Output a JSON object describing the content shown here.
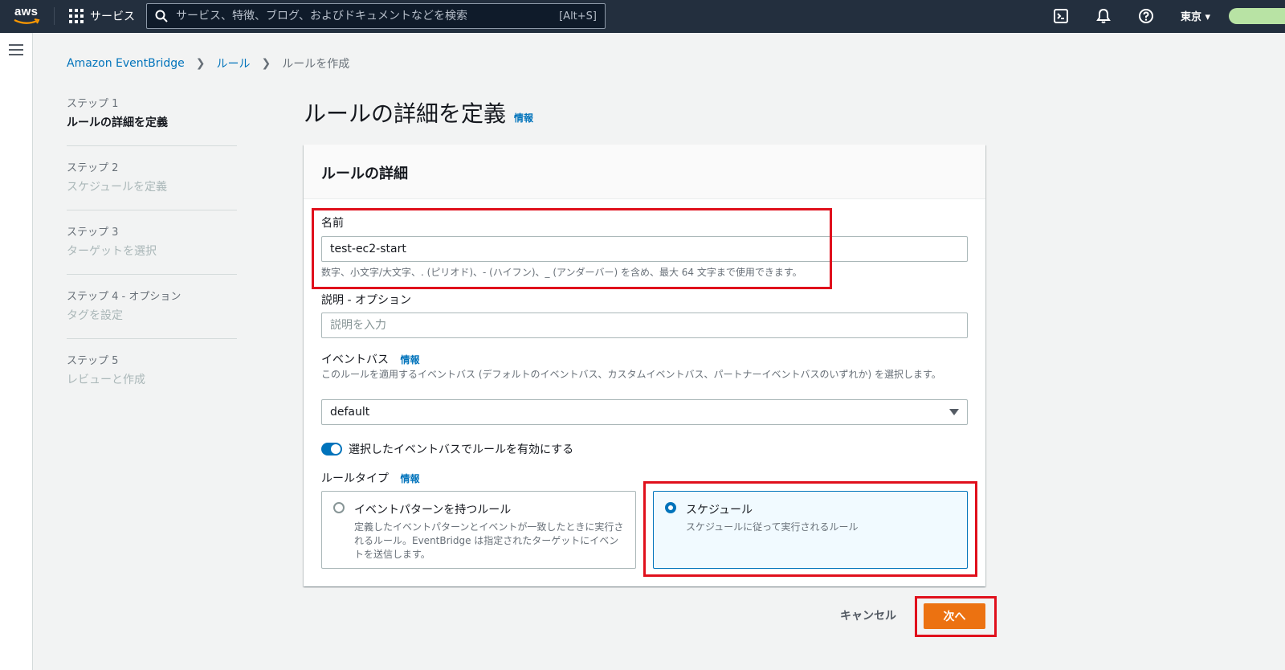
{
  "topnav": {
    "logo_text": "aws",
    "services_label": "サービス",
    "search_placeholder": "サービス、特徴、ブログ、およびドキュメントなどを検索",
    "search_shortcut": "[Alt+S]",
    "region": "東京 ▾"
  },
  "breadcrumb": {
    "items": [
      "Amazon EventBridge",
      "ルール",
      "ルールを作成"
    ]
  },
  "steps": [
    {
      "num": "ステップ 1",
      "name": "ルールの詳細を定義"
    },
    {
      "num": "ステップ 2",
      "name": "スケジュールを定義"
    },
    {
      "num": "ステップ 3",
      "name": "ターゲットを選択"
    },
    {
      "num": "ステップ 4 - オプション",
      "name": "タグを設定"
    },
    {
      "num": "ステップ 5",
      "name": "レビューと作成"
    }
  ],
  "page": {
    "title": "ルールの詳細を定義",
    "info": "情報"
  },
  "panel": {
    "header": "ルールの詳細",
    "name_label": "名前",
    "name_value": "test-ec2-start",
    "name_hint": "数字、小文字/大文字、. (ピリオド)、- (ハイフン)、_ (アンダーバー) を含め、最大 64 文字まで使用できます。",
    "desc_label": "説明 - オプション",
    "desc_placeholder": "説明を入力",
    "bus_label": "イベントバス",
    "bus_info": "情報",
    "bus_hint": "このルールを適用するイベントバス (デフォルトのイベントバス、カスタムイベントバス、パートナーイベントバスのいずれか) を選択します。",
    "bus_value": "default",
    "toggle_label": "選択したイベントバスでルールを有効にする",
    "rule_type_label": "ルールタイプ",
    "rule_type_info": "情報",
    "option_pattern_title": "イベントパターンを持つルール",
    "option_pattern_desc": "定義したイベントパターンとイベントが一致したときに実行されるルール。EventBridge は指定されたターゲットにイベントを送信します。",
    "option_schedule_title": "スケジュール",
    "option_schedule_desc": "スケジュールに従って実行されるルール"
  },
  "actions": {
    "cancel": "キャンセル",
    "next": "次へ"
  },
  "colors": {
    "nav_bg": "#232f3e",
    "link": "#0073bb",
    "primary_button": "#ec7211",
    "highlight_box": "#e0101c"
  }
}
